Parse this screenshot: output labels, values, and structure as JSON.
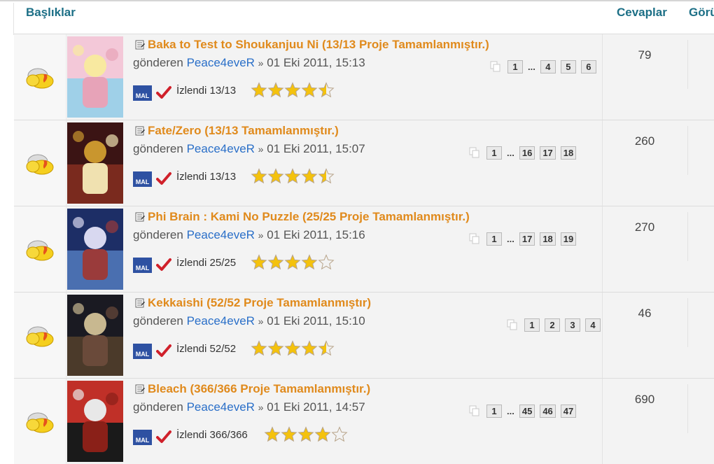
{
  "header": {
    "topics_label": "Başlıklar",
    "replies_label": "Cevaplar",
    "views_label": "Görü"
  },
  "colors": {
    "title": "#e08a1c",
    "author": "#2a6fc8",
    "header": "#1c6f86",
    "star": "#f4c20d"
  },
  "threads": [
    {
      "title": "Baka to Test to Shoukanjuu Ni (13/13 Proje Tamamlanmıştır.)",
      "by": "gönderen",
      "author": "Peace4eveR",
      "sep": "»",
      "date": "01 Eki 2011, 15:13",
      "mal": "MAL",
      "watched": "İzlendi 13/13",
      "rating": 4.5,
      "pages": [
        "1",
        "...",
        "4",
        "5",
        "6"
      ],
      "replies": "79"
    },
    {
      "title": "Fate/Zero (13/13 Tamamlanmıştır.)",
      "by": "gönderen",
      "author": "Peace4eveR",
      "sep": "»",
      "date": "01 Eki 2011, 15:07",
      "mal": "MAL",
      "watched": "İzlendi 13/13",
      "rating": 4.5,
      "pages": [
        "1",
        "...",
        "16",
        "17",
        "18"
      ],
      "replies": "260"
    },
    {
      "title": "Phi Brain : Kami No Puzzle (25/25 Proje Tamamlanmıştır.)",
      "by": "gönderen",
      "author": "Peace4eveR",
      "sep": "»",
      "date": "01 Eki 2011, 15:16",
      "mal": "MAL",
      "watched": "İzlendi 25/25",
      "rating": 4,
      "pages": [
        "1",
        "...",
        "17",
        "18",
        "19"
      ],
      "replies": "270"
    },
    {
      "title": "Kekkaishi (52/52 Proje Tamamlanmıştır)",
      "by": "gönderen",
      "author": "Peace4eveR",
      "sep": "»",
      "date": "01 Eki 2011, 15:10",
      "mal": "MAL",
      "watched": "İzlendi 52/52",
      "rating": 4.5,
      "pages": [
        "1",
        "2",
        "3",
        "4"
      ],
      "replies": "46"
    },
    {
      "title": "Bleach (366/366 Proje Tamamlanmıştır.)",
      "by": "gönderen",
      "author": "Peace4eveR",
      "sep": "»",
      "date": "01 Eki 2011, 14:57",
      "mal": "MAL",
      "watched": "İzlendi 366/366",
      "rating": 4,
      "pages": [
        "1",
        "...",
        "45",
        "46",
        "47"
      ],
      "replies": "690"
    }
  ]
}
